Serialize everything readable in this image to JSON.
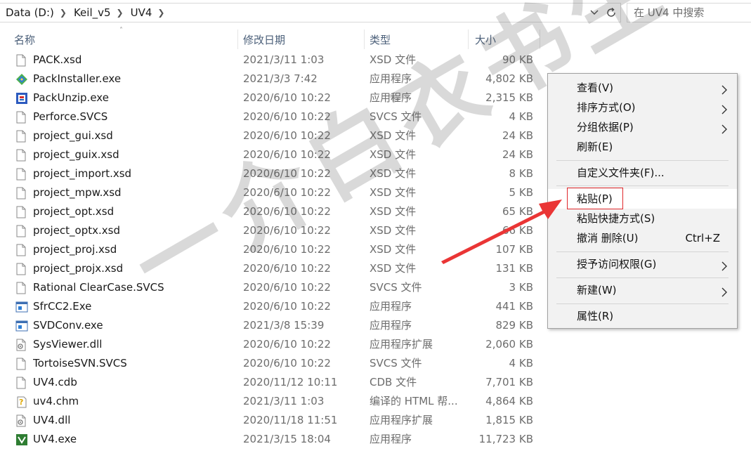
{
  "address": {
    "crumbs": [
      "Data (D:)",
      "Keil_v5",
      "UV4"
    ]
  },
  "search": {
    "placeholder": "在 UV4 中搜索"
  },
  "columns": {
    "name": "名称",
    "date": "修改日期",
    "type": "类型",
    "size": "大小"
  },
  "files": [
    {
      "name": "PACK.xsd",
      "date": "2021/3/11 1:03",
      "type": "XSD 文件",
      "size": "90 KB",
      "icon": "doc"
    },
    {
      "name": "PackInstaller.exe",
      "date": "2021/3/3 7:42",
      "type": "应用程序",
      "size": "4,802 KB",
      "icon": "pack"
    },
    {
      "name": "PackUnzip.exe",
      "date": "2020/6/10 10:22",
      "type": "应用程序",
      "size": "2,315 KB",
      "icon": "unzip"
    },
    {
      "name": "Perforce.SVCS",
      "date": "2020/6/10 10:22",
      "type": "SVCS 文件",
      "size": "4 KB",
      "icon": "doc"
    },
    {
      "name": "project_gui.xsd",
      "date": "2020/6/10 10:22",
      "type": "XSD 文件",
      "size": "24 KB",
      "icon": "doc"
    },
    {
      "name": "project_guix.xsd",
      "date": "2020/6/10 10:22",
      "type": "XSD 文件",
      "size": "24 KB",
      "icon": "doc"
    },
    {
      "name": "project_import.xsd",
      "date": "2020/6/10 10:22",
      "type": "XSD 文件",
      "size": "8 KB",
      "icon": "doc"
    },
    {
      "name": "project_mpw.xsd",
      "date": "2020/6/10 10:22",
      "type": "XSD 文件",
      "size": "5 KB",
      "icon": "doc"
    },
    {
      "name": "project_opt.xsd",
      "date": "2020/6/10 10:22",
      "type": "XSD 文件",
      "size": "65 KB",
      "icon": "doc"
    },
    {
      "name": "project_optx.xsd",
      "date": "2020/6/10 10:22",
      "type": "XSD 文件",
      "size": "66 KB",
      "icon": "doc"
    },
    {
      "name": "project_proj.xsd",
      "date": "2020/6/10 10:22",
      "type": "XSD 文件",
      "size": "107 KB",
      "icon": "doc"
    },
    {
      "name": "project_projx.xsd",
      "date": "2020/6/10 10:22",
      "type": "XSD 文件",
      "size": "131 KB",
      "icon": "doc"
    },
    {
      "name": "Rational ClearCase.SVCS",
      "date": "2020/6/10 10:22",
      "type": "SVCS 文件",
      "size": "3 KB",
      "icon": "doc"
    },
    {
      "name": "SfrCC2.Exe",
      "date": "2020/6/10 10:22",
      "type": "应用程序",
      "size": "441 KB",
      "icon": "app"
    },
    {
      "name": "SVDConv.exe",
      "date": "2021/3/8 15:39",
      "type": "应用程序",
      "size": "829 KB",
      "icon": "app"
    },
    {
      "name": "SysViewer.dll",
      "date": "2020/6/10 10:22",
      "type": "应用程序扩展",
      "size": "2,060 KB",
      "icon": "dll"
    },
    {
      "name": "TortoiseSVN.SVCS",
      "date": "2020/6/10 10:22",
      "type": "SVCS 文件",
      "size": "4 KB",
      "icon": "doc"
    },
    {
      "name": "UV4.cdb",
      "date": "2020/11/12 10:11",
      "type": "CDB 文件",
      "size": "7,701 KB",
      "icon": "doc"
    },
    {
      "name": "uv4.chm",
      "date": "2021/3/11 1:03",
      "type": "编译的 HTML 帮...",
      "size": "4,864 KB",
      "icon": "chm"
    },
    {
      "name": "UV4.dll",
      "date": "2020/11/18 11:51",
      "type": "应用程序扩展",
      "size": "1,815 KB",
      "icon": "dll"
    },
    {
      "name": "UV4.exe",
      "date": "2021/3/15 18:04",
      "type": "应用程序",
      "size": "11,723 KB",
      "icon": "uv4"
    }
  ],
  "menu": {
    "view": "查看(V)",
    "sort": "排序方式(O)",
    "group": "分组依据(P)",
    "refresh": "刷新(E)",
    "customize": "自定义文件夹(F)...",
    "paste": "粘贴(P)",
    "paste_shortcut": "粘贴快捷方式(S)",
    "undo": "撤消 删除(U)",
    "undo_shortcut": "Ctrl+Z",
    "grant": "授予访问权限(G)",
    "new": "新建(W)",
    "properties": "属性(R)"
  },
  "watermark": "一介白衣书生",
  "colors": {
    "accent": "#e0282c",
    "header_text": "#4c607a",
    "meta_text": "#6d6d6d"
  }
}
